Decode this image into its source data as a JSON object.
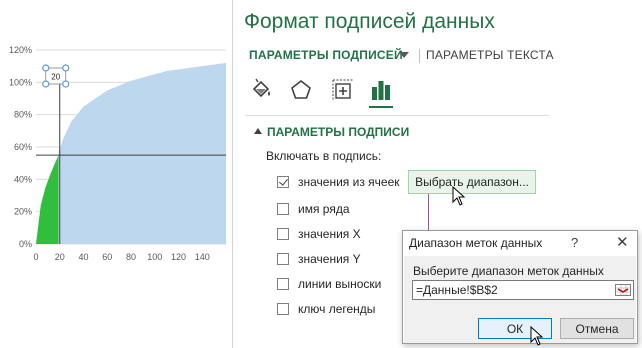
{
  "chart_data": {
    "type": "area",
    "x_ticks": [
      "0",
      "20",
      "40",
      "60",
      "80",
      "100",
      "120",
      "140"
    ],
    "y_ticks": [
      "0%",
      "20%",
      "40%",
      "60%",
      "80%",
      "100%",
      "120%"
    ],
    "xlim": [
      0,
      160
    ],
    "ylim": [
      0,
      1.2
    ],
    "crosshair": {
      "x": 20,
      "y": 0.55
    },
    "data_label": "20",
    "series": [
      {
        "name": "",
        "color": "#2fbf3c",
        "x": [
          0,
          4,
          8,
          12,
          16,
          19
        ],
        "y": [
          0.0,
          0.24,
          0.35,
          0.43,
          0.5,
          0.55
        ]
      },
      {
        "name": "",
        "color": "#bdd7ee",
        "x": [
          19,
          24,
          30,
          40,
          50,
          60,
          70,
          80,
          90,
          100,
          110,
          120,
          130,
          140,
          150,
          160
        ],
        "y": [
          0.57,
          0.67,
          0.76,
          0.85,
          0.9,
          0.95,
          0.98,
          1.01,
          1.03,
          1.05,
          1.07,
          1.08,
          1.09,
          1.1,
          1.11,
          1.12
        ]
      }
    ]
  },
  "pane": {
    "title": "Формат подписей данных",
    "tab_label_options": "ПАРАМЕТРЫ ПОДПИСЕЙ",
    "tab_text_options": "ПАРАМЕТРЫ ТЕКСТА",
    "section_title": "ПАРАМЕТРЫ ПОДПИСИ",
    "include_label": "Включать в подпись:",
    "select_range_label": "Выбрать диапазон...",
    "accent_color": "#217346",
    "checkboxes": [
      {
        "label": "значения из ячеек",
        "checked": true
      },
      {
        "label": "имя ряда",
        "checked": false
      },
      {
        "label": "значения X",
        "checked": false
      },
      {
        "label": "значения Y",
        "checked": false
      },
      {
        "label": "линии выноски",
        "checked": false
      },
      {
        "label": "ключ легенды",
        "checked": false
      }
    ]
  },
  "dialog": {
    "title": "Диапазон меток данных",
    "help": "?",
    "close": "✕",
    "prompt": "Выберите диапазон меток данных",
    "input_value": "=Данные!$B$2",
    "ok_label": "ОК",
    "cancel_label": "Отмена"
  }
}
